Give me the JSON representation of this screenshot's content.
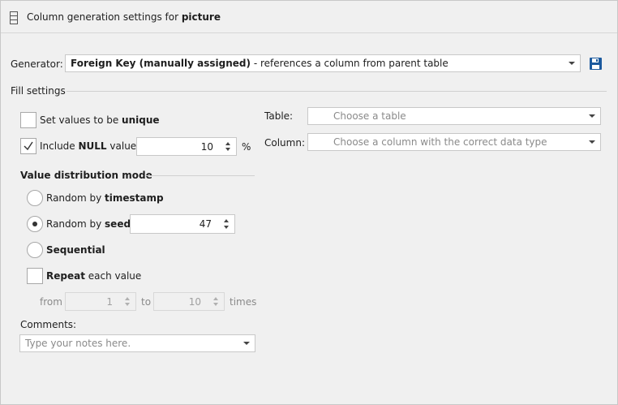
{
  "header": {
    "title_prefix": "Column generation settings for ",
    "title_column": "picture",
    "icon": "column-grid-icon"
  },
  "generator": {
    "label": "Generator:",
    "value_bold": "Foreign Key (manually assigned)",
    "value_rest": " - references a column from parent table",
    "save_icon": "floppy-disk-icon"
  },
  "fill_settings": {
    "title": "Fill settings",
    "unique": {
      "text": "Set values to be ",
      "bold": "unique",
      "checked": false
    },
    "include_null": {
      "text_pre": "Include ",
      "bold": "NULL",
      "text_post": " values",
      "checked": true,
      "value": "10",
      "unit": "%"
    },
    "distribution": {
      "title": "Value distribution mode",
      "random_timestamp": {
        "text": "Random by ",
        "bold": "timestamp",
        "selected": false
      },
      "random_seed": {
        "text": "Random by ",
        "bold": "seed",
        "selected": true,
        "value": "47"
      },
      "sequential": {
        "bold": "Sequential",
        "selected": false
      },
      "repeat": {
        "bold": "Repeat",
        "text": " each value",
        "checked": false,
        "from_label": "from",
        "from_value": "1",
        "to_label": "to",
        "to_value": "10",
        "times_label": "times"
      }
    },
    "comments": {
      "label": "Comments:",
      "placeholder": "Type your notes here."
    }
  },
  "reference": {
    "table_label": "Table:",
    "table_placeholder": "Choose a table",
    "column_label": "Column:",
    "column_placeholder": "Choose a column with the correct data type"
  }
}
